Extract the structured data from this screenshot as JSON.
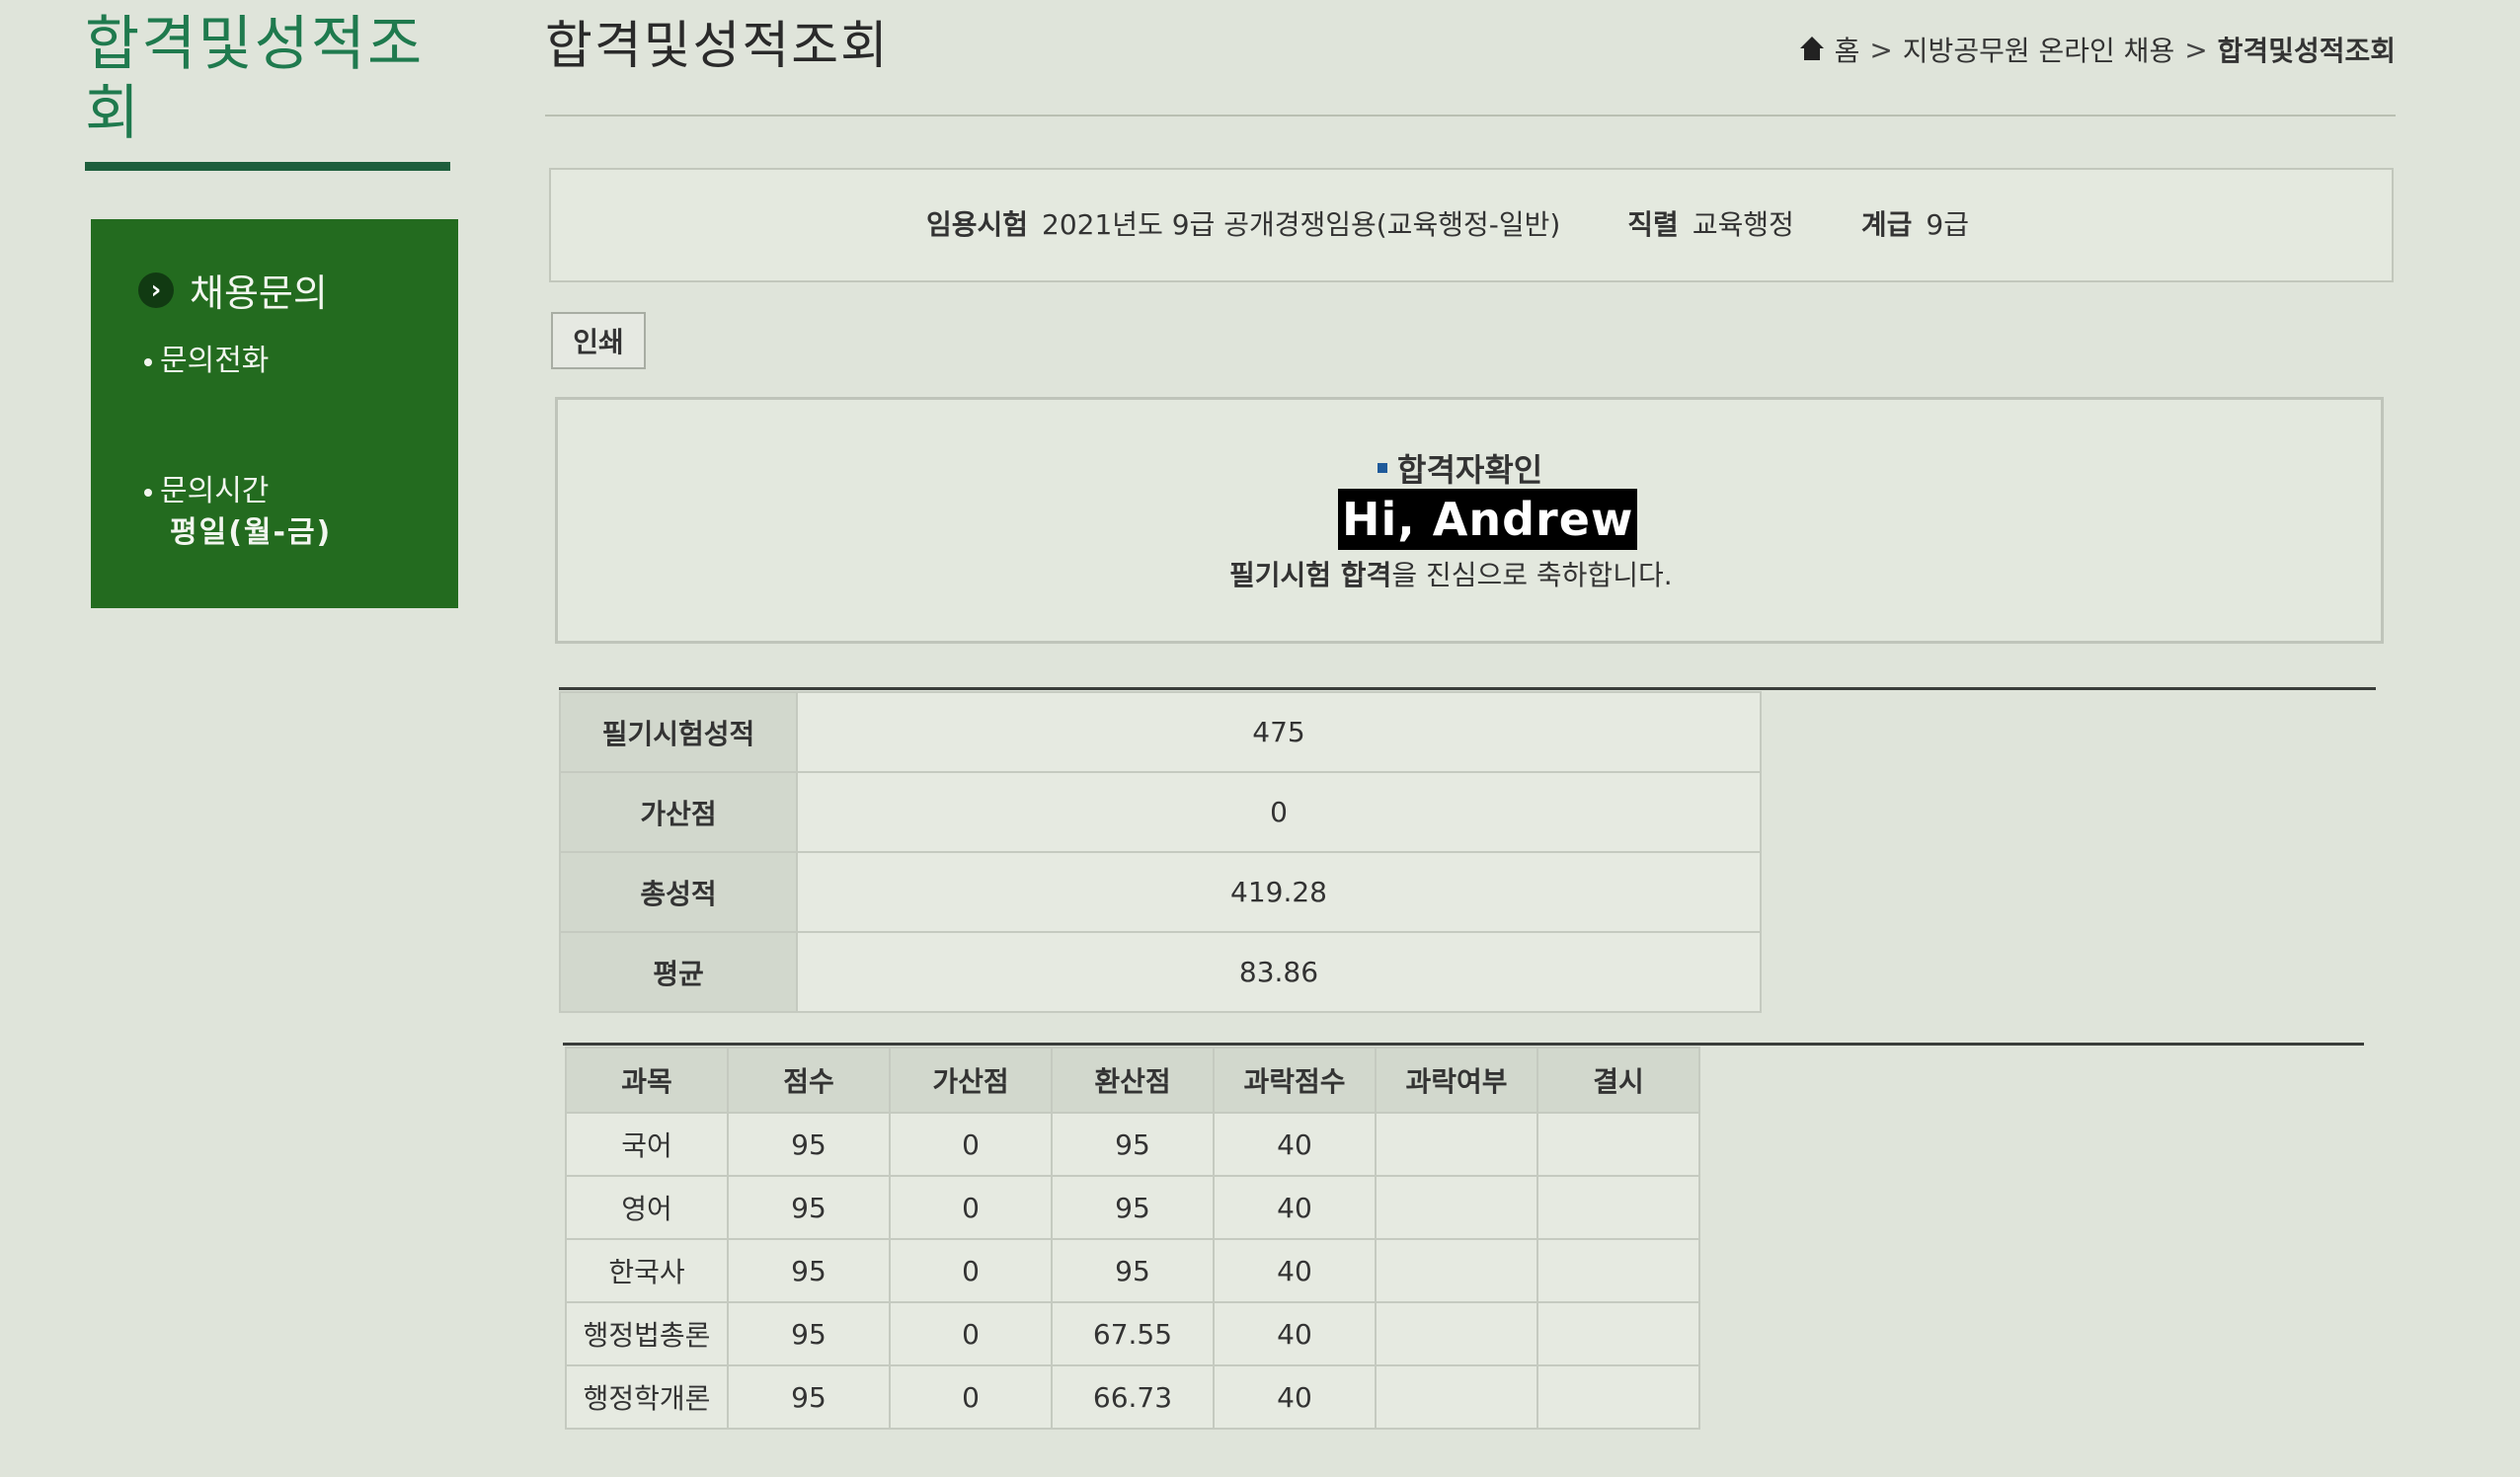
{
  "sidebar": {
    "title": "합격및성적조회",
    "section_title": "채용문의",
    "items": [
      {
        "label": "문의전화"
      },
      {
        "label": "문의시간",
        "sub": "평일(월-금)"
      }
    ]
  },
  "header": {
    "title": "합격및성적조회",
    "breadcrumb": [
      "홈",
      "지방공무원 온라인 채용",
      "합격및성적조회"
    ]
  },
  "exam": {
    "exam_label": "임용시험",
    "exam_value": "2021년도 9급 공개경쟁임용(교육행정-일반)",
    "series_label": "직렬",
    "series_value": "교육행정",
    "grade_label": "계급",
    "grade_value": "9급"
  },
  "print_label": "인쇄",
  "pass": {
    "heading": "합격자확인",
    "name": "Hi,  Andrew",
    "message_bold": "필기시험 합격",
    "message_rest": "을 진심으로 축하합니다."
  },
  "summary": {
    "rows": [
      {
        "label": "필기시험성적",
        "value": "475"
      },
      {
        "label": "가산점",
        "value": "0"
      },
      {
        "label": "총성적",
        "value": "419.28"
      },
      {
        "label": "평균",
        "value": "83.86"
      }
    ]
  },
  "subjects": {
    "headers": [
      "과목",
      "점수",
      "가산점",
      "환산점",
      "과락점수",
      "과락여부",
      "결시"
    ],
    "rows": [
      [
        "국어",
        "95",
        "0",
        "95",
        "40",
        "",
        ""
      ],
      [
        "영어",
        "95",
        "0",
        "95",
        "40",
        "",
        ""
      ],
      [
        "한국사",
        "95",
        "0",
        "95",
        "40",
        "",
        ""
      ],
      [
        "행정법총론",
        "95",
        "0",
        "67.55",
        "40",
        "",
        ""
      ],
      [
        "행정학개론",
        "95",
        "0",
        "66.73",
        "40",
        "",
        ""
      ]
    ]
  }
}
